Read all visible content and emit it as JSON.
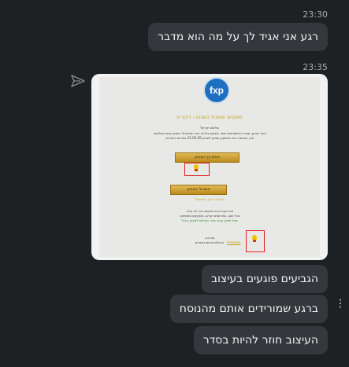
{
  "chat": {
    "timestamp_1": "23:30",
    "message_1": "רגע אני אגיד לך על מה הוא מדבר",
    "timestamp_2": "23:35",
    "message_2": "הגביעים פוגעים בעיצוב",
    "message_3": "ברגע שמורידים אותם מהנוסח",
    "message_4": "העיצוב חוזר להיות בסדר"
  },
  "email_image": {
    "logo_text": "fxp",
    "title": "משקיענ ואשכול השבוע - דיבורים",
    "greeting": "גולשים יקרים!",
    "body_line_1": "כמדי שבוע, קמחי הכשמתמש אשר השקיע בלהיט חבר שאשכול השבוע ואת הגולשים.",
    "body_line_2": "את, ובכתבה את המשקיע שבוע לשבוע 21.05.20 בפורום דיבורים.",
    "button_1": "משקיען השבוע",
    "button_2": "אשכול השבוע",
    "link_1": "להצבה לינק האשכול!",
    "note_1": "אנא נקנו ברוא פונשת אירי יפי אתר.",
    "note_2": "בכל שבו, בפורומים יקרים, משקיעים מזמינים.",
    "note_3": "מוזל שבוע עבור חבר וקהלים לשבוע הבא!",
    "signoff": "בברכה,",
    "signature": "הנהלת פורום דיבורים",
    "footer_link": "freestyle"
  },
  "colors": {
    "background": "#1e2124",
    "bubble": "#34383d",
    "gold": "#c4a216",
    "highlight_box": "#e02020"
  },
  "icons": [
    "share-icon",
    "more-options-icon",
    "fxp-logo",
    "trophy-icon"
  ]
}
